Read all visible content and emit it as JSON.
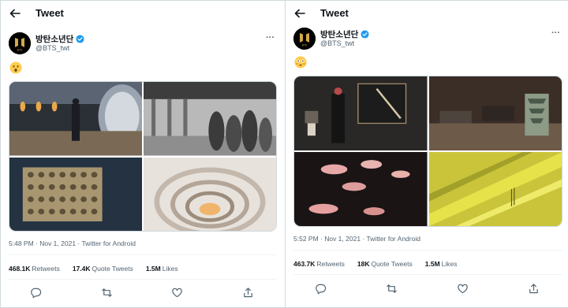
{
  "tweets": [
    {
      "header_title": "Tweet",
      "name": "방탄소년단",
      "handle": "@BTS_twt",
      "more": "···",
      "timestamp": "5:48 PM · Nov 1, 2021 · Twitter for Android",
      "stats": {
        "retweets_count": "468.1K",
        "retweets_label": "Retweets",
        "quotes_count": "17.4K",
        "quotes_label": "Quote Tweets",
        "likes_count": "1.5M",
        "likes_label": "Likes"
      }
    },
    {
      "header_title": "Tweet",
      "name": "방탄소년단",
      "handle": "@BTS_twt",
      "more": "···",
      "timestamp": "5:52 PM · Nov 1, 2021 · Twitter for Android",
      "stats": {
        "retweets_count": "463.7K",
        "retweets_label": "Retweets",
        "quotes_count": "18K",
        "quotes_label": "Quote Tweets",
        "likes_count": "1.5M",
        "likes_label": "Likes"
      }
    }
  ],
  "colors": {
    "verified": "#1d9bf0",
    "secondary_text": "#536471",
    "border": "#cfd9de",
    "brand_gold": "#d4a94a"
  },
  "icons": [
    "back-arrow-icon",
    "verified-badge-icon",
    "more-icon",
    "reply-icon",
    "retweet-icon",
    "like-icon",
    "share-icon"
  ]
}
